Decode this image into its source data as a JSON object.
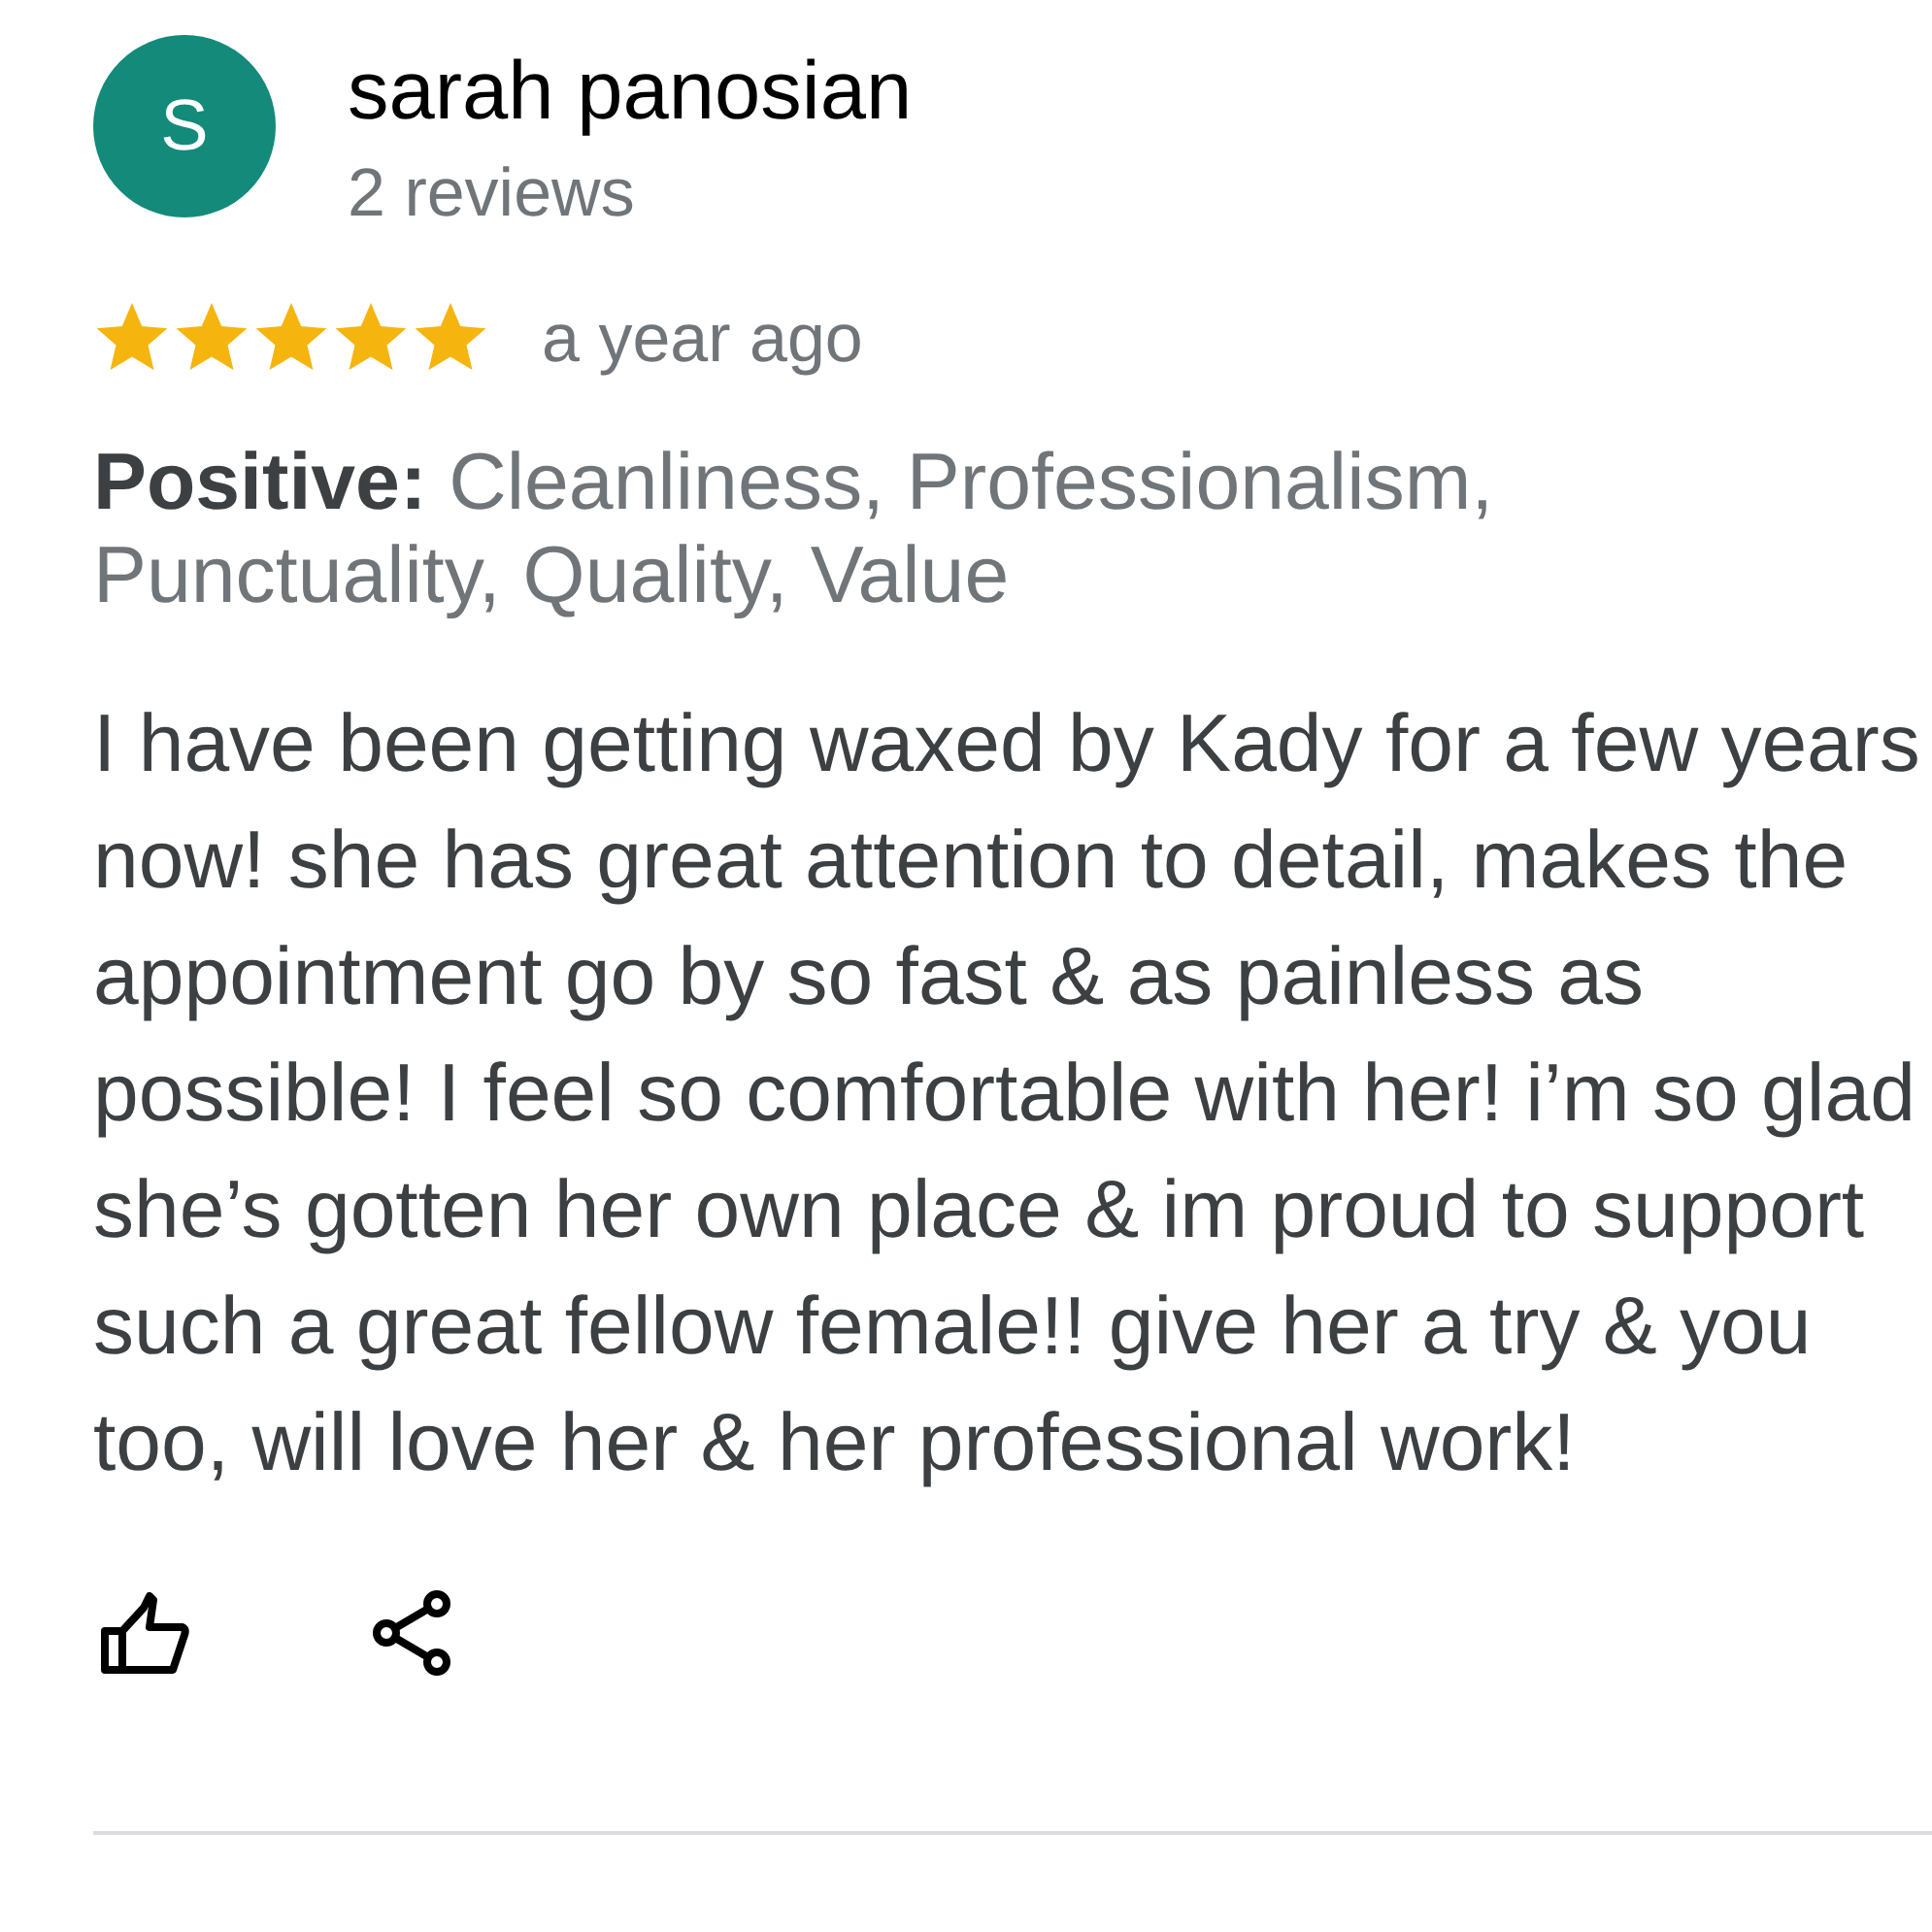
{
  "review": {
    "author": {
      "initial": "S",
      "name": "sarah panosian",
      "reviews": "2 reviews"
    },
    "stars": 5,
    "time": "a year ago",
    "highlights": {
      "label": "Positive:",
      "text": "Cleanliness, Professionalism, Punctuality, Quality, Value"
    },
    "body": "I have been getting waxed by Kady for a few years now! she has great attention to detail, makes the appointment go by so fast & as painless as possible! I feel so comfortable with her! i’m so glad she’s gotten her own place & im proud to support such a great fellow female!! give her a try & you too, will love her & her professional work!",
    "actions": [
      {
        "kind": "like"
      },
      {
        "kind": "share"
      }
    ]
  }
}
